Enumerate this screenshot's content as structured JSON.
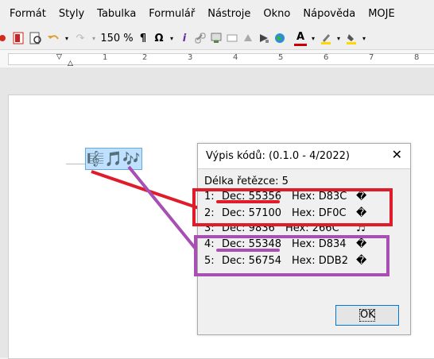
{
  "menu": {
    "items": [
      "Formát",
      "Styly",
      "Tabulka",
      "Formulář",
      "Nástroje",
      "Okno",
      "Nápověda",
      "MOJE"
    ]
  },
  "toolbar": {
    "zoom": "150 %",
    "pilcrow": "¶",
    "omega": "Ω",
    "text_color_icon": "A"
  },
  "ruler": {
    "numbers": [
      "1",
      "2",
      "3",
      "4",
      "5",
      "6",
      "7",
      "8"
    ]
  },
  "document": {
    "symbols": "🎼🎵🎶"
  },
  "dialog": {
    "title": "Výpis kódů:  (0.1.0 - 4/2022)",
    "close": "✕",
    "length_line": "Délka řetězce: 5",
    "rows": [
      {
        "n": "1:",
        "dec": "Dec: 55356",
        "hex": "Hex: D83C",
        "ch": "�"
      },
      {
        "n": "2:",
        "dec": "Dec: 57100",
        "hex": "Hex: DF0C",
        "ch": "�"
      },
      {
        "n": "3:",
        "dec": "Dec: 9836",
        "hex": "Hex: 266C",
        "ch": "♬"
      },
      {
        "n": "4:",
        "dec": "Dec: 55348",
        "hex": "Hex: D834",
        "ch": "�"
      },
      {
        "n": "5:",
        "dec": "Dec: 56754",
        "hex": "Hex: DDB2",
        "ch": "�"
      }
    ],
    "ok": "OK"
  },
  "colors": {
    "red": "#e01b2a",
    "purple": "#a74fb3",
    "selection": "#bfe0ff"
  }
}
